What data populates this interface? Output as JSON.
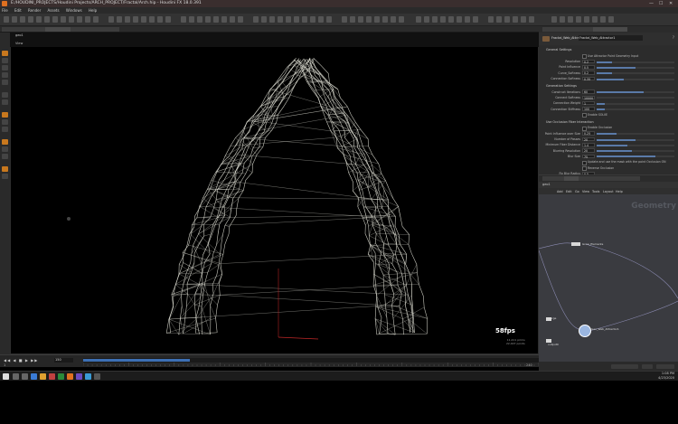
{
  "window": {
    "title": "E:/HOUDINI_PROJECTS/Houdini Projects/ARCH_PROJECT/Fractal/Arch.hip - Houdini FX 18.0.391",
    "minimize": "—",
    "maximize": "☐",
    "close": "✕"
  },
  "menu": [
    "File",
    "Edit",
    "Render",
    "Assets",
    "Windows",
    "Help"
  ],
  "viewer": {
    "path_node": "geo1",
    "camera": "View",
    "fps": "58fps",
    "stats": [
      "11,211 prims",
      "22,407 points"
    ]
  },
  "network": {
    "watermark": "Geometry",
    "menu": [
      "Add",
      "Edit",
      "Go",
      "View",
      "Tools",
      "Layout",
      "Help"
    ],
    "nodes": [
      {
        "label": "Grow_Elements"
      },
      {
        "label": "Merge"
      },
      {
        "label": "Geo_Web_Attractor1"
      },
      {
        "label": "output0"
      }
    ]
  },
  "params": {
    "node_type": "Fractal_Web_Attractor",
    "node_name": "Fractal_Web_Attractor1",
    "section1": "General Settings",
    "toggle1": "Use Attractor Point Geometry Input",
    "rows1": [
      {
        "label": "Resolution",
        "value": "0.2",
        "fill": 0.2
      },
      {
        "label": "Point Influence",
        "value": "0.5",
        "fill": 0.5
      },
      {
        "label": "Curve_Softness",
        "value": "0.2",
        "fill": 0.2
      },
      {
        "label": "Connection Softness",
        "value": "0.35",
        "fill": 0.35
      }
    ],
    "section2": "Generation Settings",
    "rows2": [
      {
        "label": "Construct Iterations",
        "value": "60",
        "fill": 0.6
      },
      {
        "label": "Connect Softness",
        "value": "10000",
        "fill": 0.0
      },
      {
        "label": "Connection Weight",
        "value": "1",
        "fill": 0.1
      },
      {
        "label": "Connection Stiffness",
        "value": "100",
        "fill": 0.1
      }
    ],
    "toggle2": "Enable SOLVE",
    "section3": "Use Occlusion Fiber Interaction",
    "toggle3": "Enable Occlusion",
    "rows3": [
      {
        "label": "Point Influence over Size",
        "value": "0.25",
        "fill": 0.25
      },
      {
        "label": "Number of Passes",
        "value": "20",
        "fill": 0.5
      },
      {
        "label": "Minimum Fiber Distance",
        "value": "1.4",
        "fill": 0.4
      },
      {
        "label": "Blurring Resolution",
        "value": "20",
        "fill": 0.45
      },
      {
        "label": "Blur Size",
        "value": "75",
        "fill": 0.75
      }
    ],
    "toggle4": "Update and use the mask with the point Occlusion ON",
    "toggle5": "Reverse Occlusion",
    "row_last": {
      "label": "Fix Blur Radius",
      "value": "0.5"
    }
  },
  "timeline": {
    "frame": "150",
    "start": "1",
    "end": "240"
  },
  "taskbar": {
    "time": "1:08 PM",
    "date": "4/23/2020"
  },
  "colors": {
    "accent": "#c8781e",
    "timeline_blue": "#3c6fb4",
    "web_strand": "#e8e8dc"
  }
}
